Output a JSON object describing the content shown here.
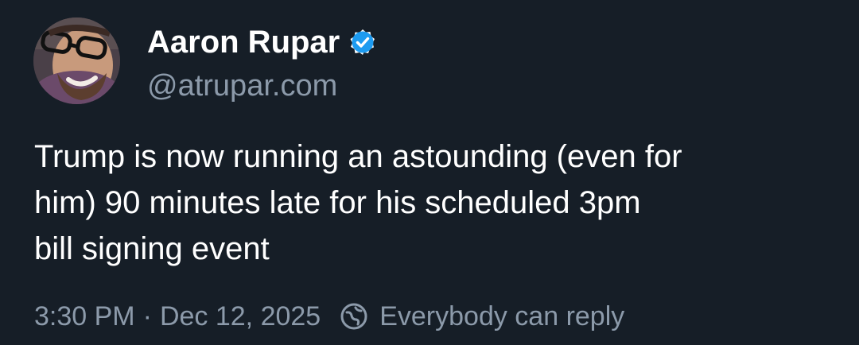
{
  "post": {
    "author": {
      "display_name": "Aaron Rupar",
      "handle": "@atrupar.com",
      "verified": true,
      "avatar_icon": "user-avatar"
    },
    "text": "Trump is now running an astounding (even for\nhim) 90 minutes late for his scheduled 3pm\nbill signing event",
    "meta": {
      "time": "3:30 PM",
      "separator": "·",
      "date": "Dec 12, 2025",
      "reply_setting_icon": "reply-permission-icon",
      "reply_setting": "Everybody can reply"
    }
  },
  "colors": {
    "background": "#161e27",
    "text_primary": "#ffffff",
    "text_secondary": "#8c9aaa",
    "verified_badge": "#1d9bf0"
  }
}
